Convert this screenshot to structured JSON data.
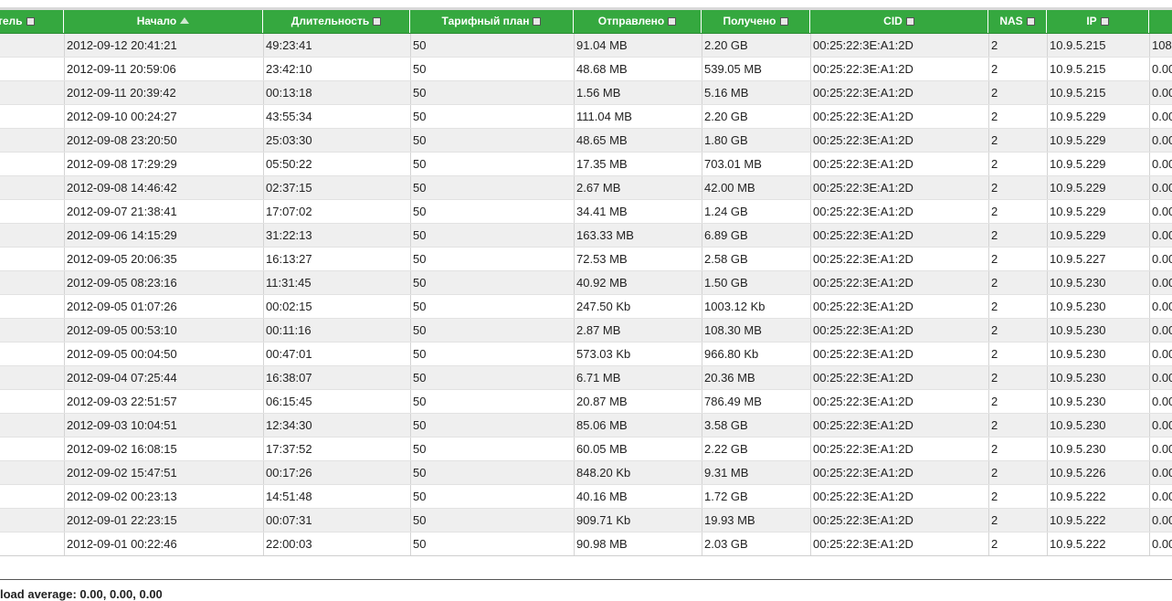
{
  "table": {
    "columns": [
      {
        "label": "тель",
        "sort": false,
        "checkbox": true
      },
      {
        "label": "Начало",
        "sort": true,
        "checkbox": false
      },
      {
        "label": "Длительность",
        "sort": false,
        "checkbox": true
      },
      {
        "label": "Тарифный план",
        "sort": false,
        "checkbox": true
      },
      {
        "label": "Отправлено",
        "sort": false,
        "checkbox": true
      },
      {
        "label": "Получено",
        "sort": false,
        "checkbox": true
      },
      {
        "label": "CID",
        "sort": false,
        "checkbox": true
      },
      {
        "label": "NAS",
        "sort": false,
        "checkbox": true
      },
      {
        "label": "IP",
        "sort": false,
        "checkbox": true
      },
      {
        "label": "",
        "sort": false,
        "checkbox": false
      }
    ],
    "rows": [
      [
        "",
        "2012-09-12 20:41:21",
        "49:23:41",
        "50",
        "91.04 MB",
        "2.20 GB",
        "00:25:22:3E:A1:2D",
        "2",
        "10.9.5.215",
        "108"
      ],
      [
        "",
        "2012-09-11 20:59:06",
        "23:42:10",
        "50",
        "48.68 MB",
        "539.05 MB",
        "00:25:22:3E:A1:2D",
        "2",
        "10.9.5.215",
        "0.00"
      ],
      [
        "",
        "2012-09-11 20:39:42",
        "00:13:18",
        "50",
        "1.56 MB",
        "5.16 MB",
        "00:25:22:3E:A1:2D",
        "2",
        "10.9.5.215",
        "0.00"
      ],
      [
        "",
        "2012-09-10 00:24:27",
        "43:55:34",
        "50",
        "111.04 MB",
        "2.20 GB",
        "00:25:22:3E:A1:2D",
        "2",
        "10.9.5.229",
        "0.00"
      ],
      [
        "",
        "2012-09-08 23:20:50",
        "25:03:30",
        "50",
        "48.65 MB",
        "1.80 GB",
        "00:25:22:3E:A1:2D",
        "2",
        "10.9.5.229",
        "0.00"
      ],
      [
        "",
        "2012-09-08 17:29:29",
        "05:50:22",
        "50",
        "17.35 MB",
        "703.01 MB",
        "00:25:22:3E:A1:2D",
        "2",
        "10.9.5.229",
        "0.00"
      ],
      [
        "",
        "2012-09-08 14:46:42",
        "02:37:15",
        "50",
        "2.67 MB",
        "42.00 MB",
        "00:25:22:3E:A1:2D",
        "2",
        "10.9.5.229",
        "0.00"
      ],
      [
        "",
        "2012-09-07 21:38:41",
        "17:07:02",
        "50",
        "34.41 MB",
        "1.24 GB",
        "00:25:22:3E:A1:2D",
        "2",
        "10.9.5.229",
        "0.00"
      ],
      [
        "",
        "2012-09-06 14:15:29",
        "31:22:13",
        "50",
        "163.33 MB",
        "6.89 GB",
        "00:25:22:3E:A1:2D",
        "2",
        "10.9.5.229",
        "0.00"
      ],
      [
        "",
        "2012-09-05 20:06:35",
        "16:13:27",
        "50",
        "72.53 MB",
        "2.58 GB",
        "00:25:22:3E:A1:2D",
        "2",
        "10.9.5.227",
        "0.00"
      ],
      [
        "",
        "2012-09-05 08:23:16",
        "11:31:45",
        "50",
        "40.92 MB",
        "1.50 GB",
        "00:25:22:3E:A1:2D",
        "2",
        "10.9.5.230",
        "0.00"
      ],
      [
        "",
        "2012-09-05 01:07:26",
        "00:02:15",
        "50",
        "247.50 Kb",
        "1003.12 Kb",
        "00:25:22:3E:A1:2D",
        "2",
        "10.9.5.230",
        "0.00"
      ],
      [
        "",
        "2012-09-05 00:53:10",
        "00:11:16",
        "50",
        "2.87 MB",
        "108.30 MB",
        "00:25:22:3E:A1:2D",
        "2",
        "10.9.5.230",
        "0.00"
      ],
      [
        "",
        "2012-09-05 00:04:50",
        "00:47:01",
        "50",
        "573.03 Kb",
        "966.80 Kb",
        "00:25:22:3E:A1:2D",
        "2",
        "10.9.5.230",
        "0.00"
      ],
      [
        "",
        "2012-09-04 07:25:44",
        "16:38:07",
        "50",
        "6.71 MB",
        "20.36 MB",
        "00:25:22:3E:A1:2D",
        "2",
        "10.9.5.230",
        "0.00"
      ],
      [
        "",
        "2012-09-03 22:51:57",
        "06:15:45",
        "50",
        "20.87 MB",
        "786.49 MB",
        "00:25:22:3E:A1:2D",
        "2",
        "10.9.5.230",
        "0.00"
      ],
      [
        "",
        "2012-09-03 10:04:51",
        "12:34:30",
        "50",
        "85.06 MB",
        "3.58 GB",
        "00:25:22:3E:A1:2D",
        "2",
        "10.9.5.230",
        "0.00"
      ],
      [
        "",
        "2012-09-02 16:08:15",
        "17:37:52",
        "50",
        "60.05 MB",
        "2.22 GB",
        "00:25:22:3E:A1:2D",
        "2",
        "10.9.5.230",
        "0.00"
      ],
      [
        "",
        "2012-09-02 15:47:51",
        "00:17:26",
        "50",
        "848.20 Kb",
        "9.31 MB",
        "00:25:22:3E:A1:2D",
        "2",
        "10.9.5.226",
        "0.00"
      ],
      [
        "",
        "2012-09-02 00:23:13",
        "14:51:48",
        "50",
        "40.16 MB",
        "1.72 GB",
        "00:25:22:3E:A1:2D",
        "2",
        "10.9.5.222",
        "0.00"
      ],
      [
        "",
        "2012-09-01 22:23:15",
        "00:07:31",
        "50",
        "909.71 Kb",
        "19.93 MB",
        "00:25:22:3E:A1:2D",
        "2",
        "10.9.5.222",
        "0.00"
      ],
      [
        "",
        "2012-09-01 00:22:46",
        "22:00:03",
        "50",
        "90.98 MB",
        "2.03 GB",
        "00:25:22:3E:A1:2D",
        "2",
        "10.9.5.222",
        "0.00"
      ]
    ]
  },
  "footer": {
    "load_average": "load average: 0.00, 0.00, 0.00"
  },
  "colors": {
    "header_bg": "#35a83f",
    "row_alt": "#efefef"
  }
}
